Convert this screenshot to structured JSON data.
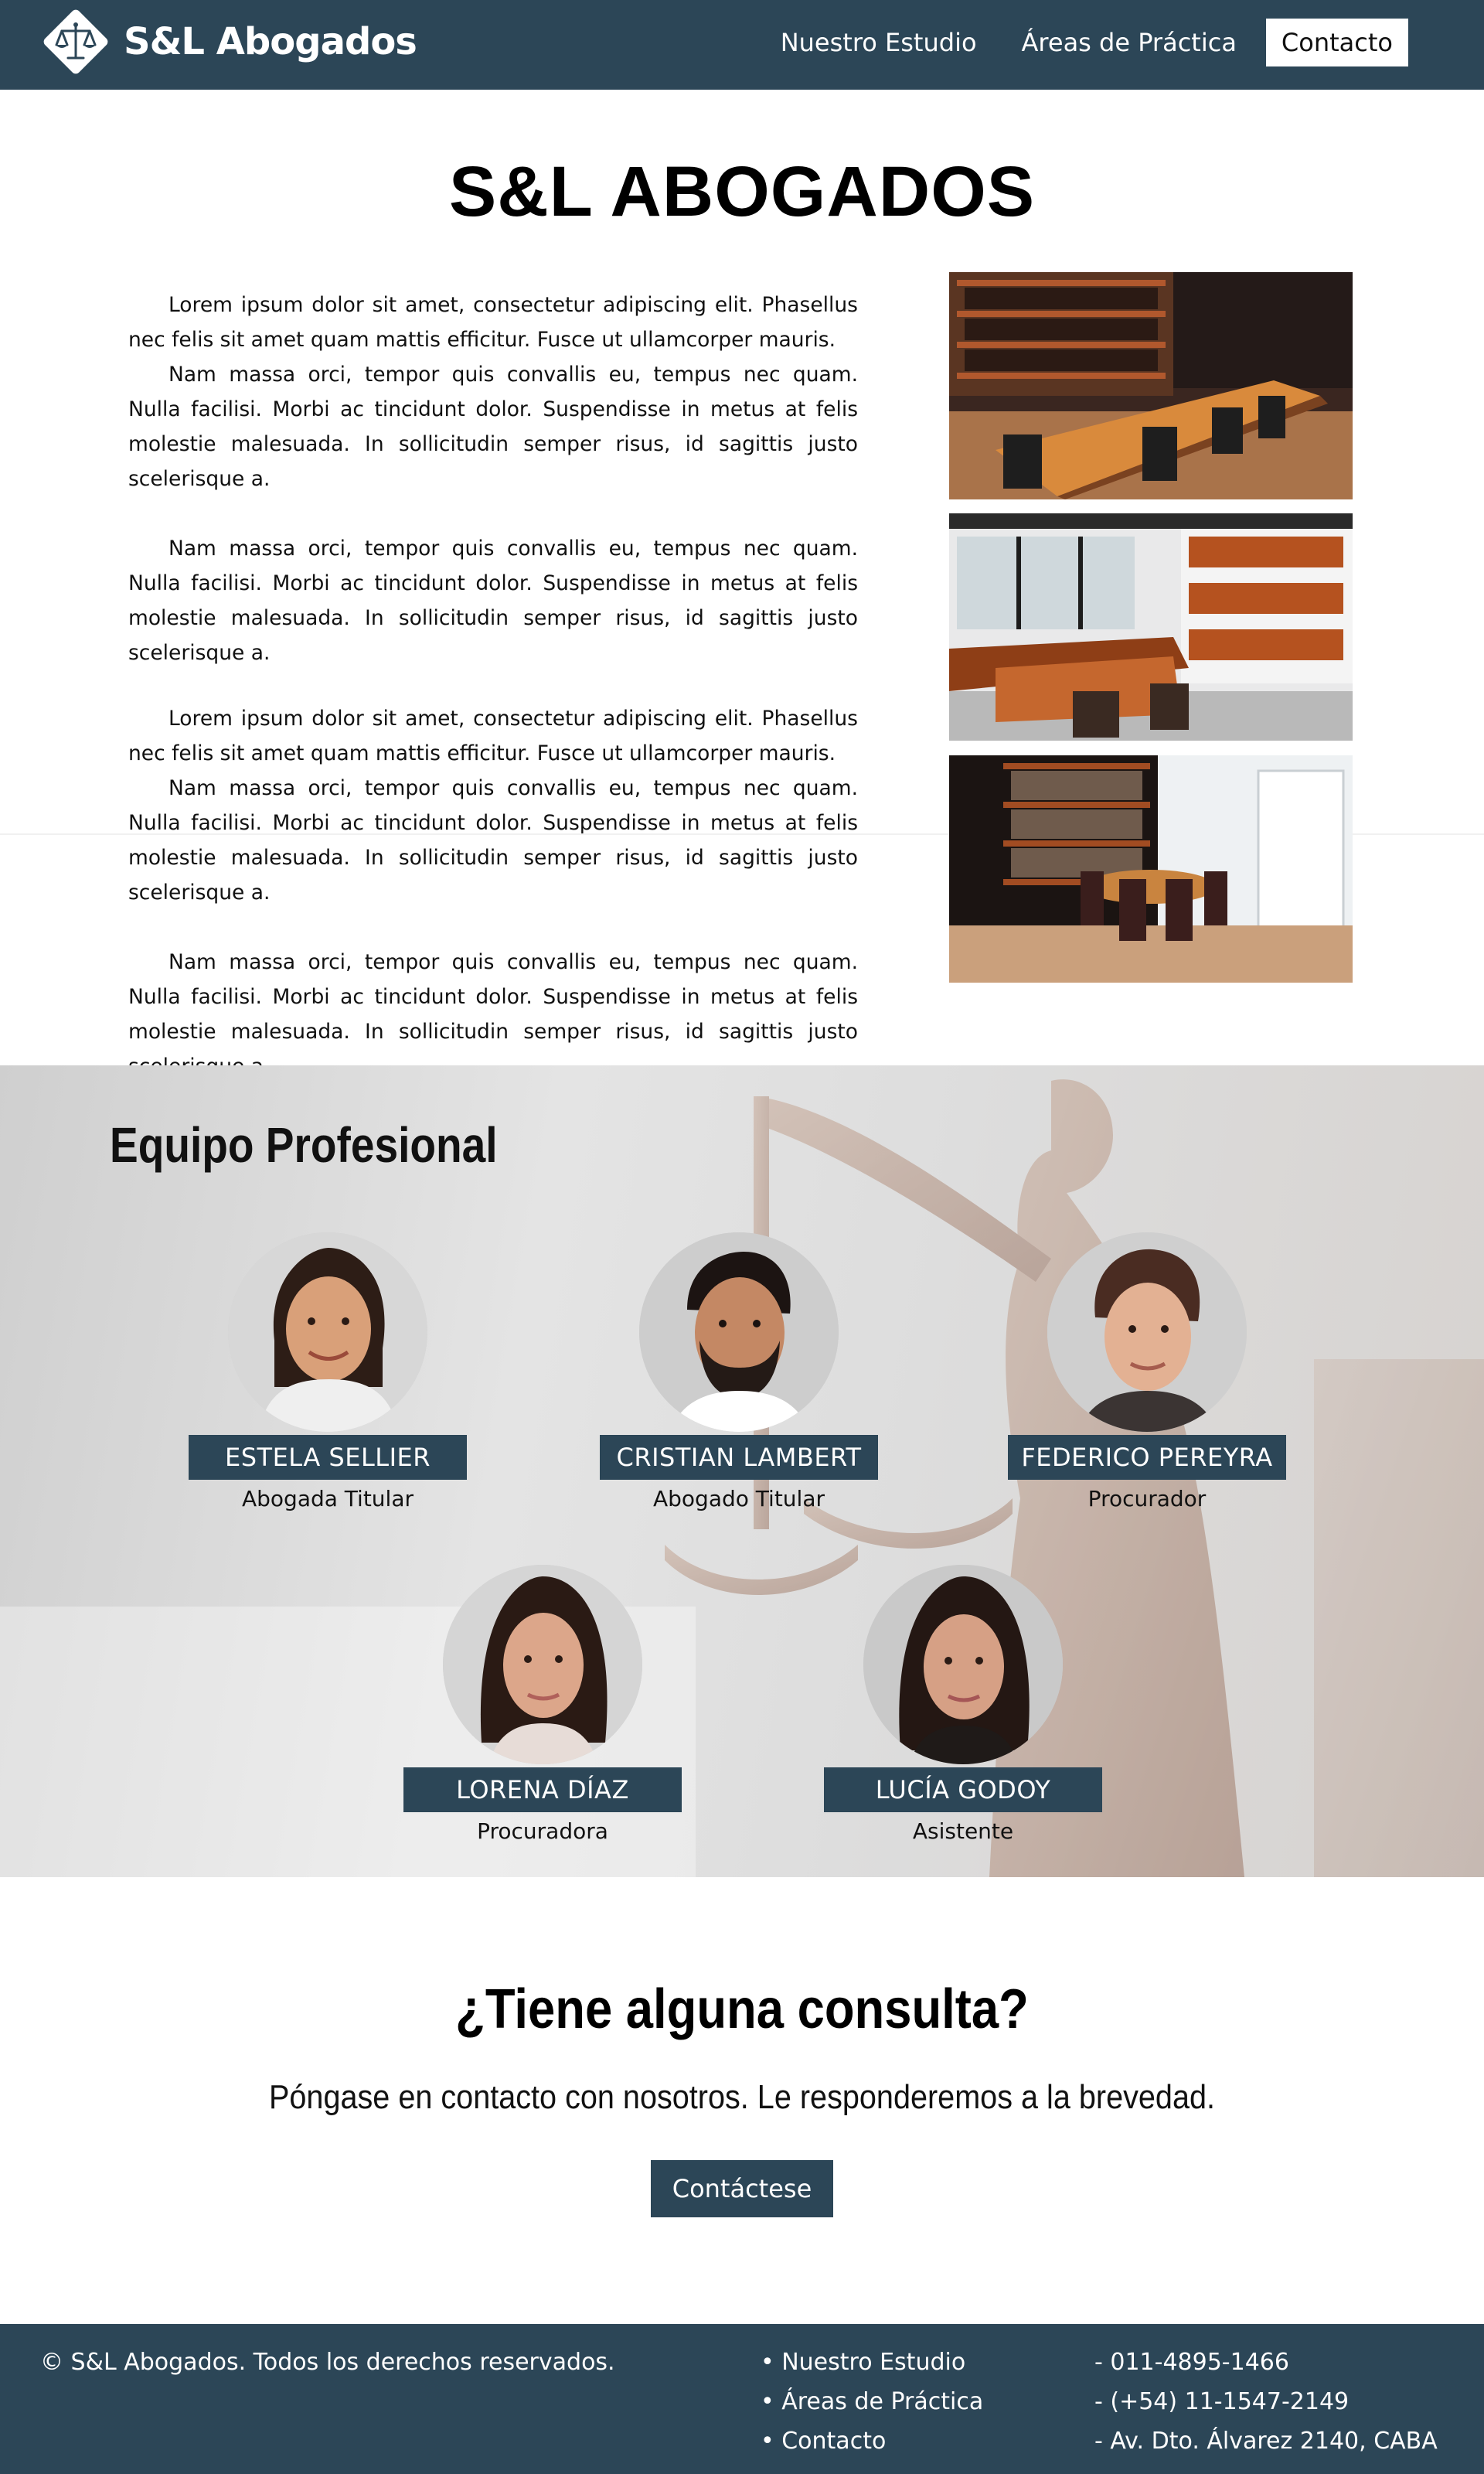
{
  "header": {
    "brand": "S&L Abogados",
    "nav": [
      "Nuestro Estudio",
      "Áreas de Práctica"
    ],
    "contact_button": "Contacto"
  },
  "intro": {
    "title": "S&L ABOGADOS",
    "paragraphs": [
      "Lorem ipsum dolor sit amet, consectetur adipiscing elit. Phasellus nec felis sit amet quam mattis efficitur. Fusce ut ullamcorper mauris.",
      "Nam massa orci, tempor quis convallis eu, tempus nec quam. Nulla facilisi. Morbi ac tincidunt dolor. Suspendisse in metus at felis molestie malesuada. In sollicitudin semper risus, id sagittis justo scelerisque a.",
      "Nam massa orci, tempor quis convallis eu, tempus nec quam. Nulla facilisi. Morbi ac tincidunt dolor. Suspendisse in metus at felis molestie malesuada. In sollicitudin semper risus, id sagittis justo scelerisque a.",
      "Lorem ipsum dolor sit amet, consectetur adipiscing elit. Phasellus nec felis sit amet quam mattis efficitur. Fusce ut ullamcorper mauris.",
      "Nam massa orci, tempor quis convallis eu, tempus nec quam. Nulla facilisi. Morbi ac tincidunt dolor. Suspendisse in metus at felis molestie malesuada. In sollicitudin semper risus, id sagittis justo scelerisque a.",
      "Nam massa orci, tempor quis convallis eu, tempus nec quam. Nulla facilisi. Morbi ac tincidunt dolor. Suspendisse in metus at felis molestie malesuada. In sollicitudin semper risus, id sagittis justo scelerisque a."
    ]
  },
  "team": {
    "title": "Equipo Profesional",
    "members": [
      {
        "name": "ESTELA SELLIER",
        "role": "Abogada Titular"
      },
      {
        "name": "CRISTIAN LAMBERT",
        "role": "Abogado Titular"
      },
      {
        "name": "FEDERICO PEREYRA",
        "role": "Procurador"
      },
      {
        "name": "LORENA DÍAZ",
        "role": "Procuradora"
      },
      {
        "name": "LUCÍA GODOY",
        "role": "Asistente"
      }
    ]
  },
  "cta": {
    "title": "¿Tiene alguna consulta?",
    "subtitle": "Póngase en contacto con nosotros. Le responderemos a la brevedad.",
    "button": "Contáctese"
  },
  "footer": {
    "copyright": "© S&L Abogados. Todos los derechos reservados.",
    "links": [
      "• Nuestro Estudio",
      "• Áreas de Práctica",
      "• Contacto"
    ],
    "contact": [
      "- 011-4895-1466",
      "- (+54) 11-1547-2149",
      "- Av. Dto. Álvarez 2140, CABA"
    ]
  },
  "colors": {
    "primary": "#2c4657",
    "white": "#ffffff",
    "text": "#111111"
  }
}
